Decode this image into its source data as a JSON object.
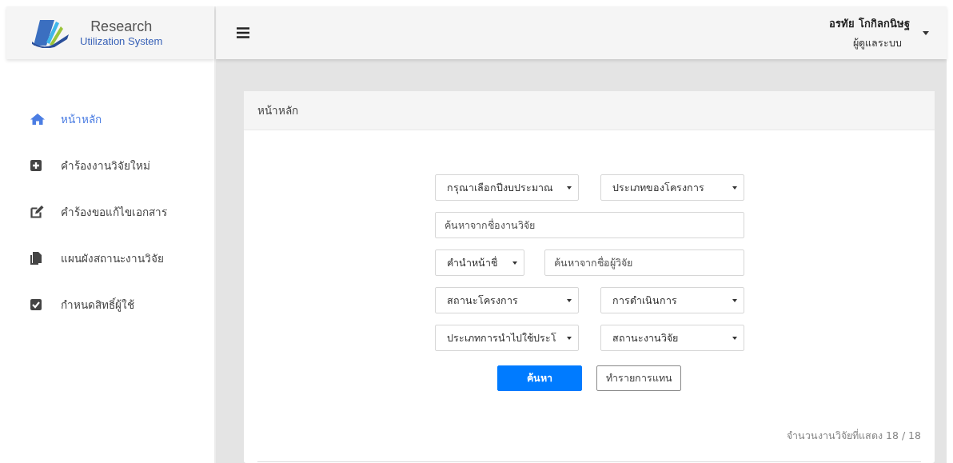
{
  "brand": {
    "title": "Research",
    "subtitle": "Utilization System"
  },
  "header": {
    "user_name": "อรทัย โกกิลกนิษฐ",
    "user_role": "ผู้ดูแลระบบ"
  },
  "sidebar": {
    "items": [
      {
        "label": "หน้าหลัก",
        "selected": true
      },
      {
        "label": "คำร้องงานวิจัยใหม่",
        "selected": false
      },
      {
        "label": "คำร้องขอแก้ไขเอกสาร",
        "selected": false
      },
      {
        "label": "แผนผังสถานะงานวิจัย",
        "selected": false
      },
      {
        "label": "กำหนดสิทธิ์ผู้ใช้",
        "selected": false
      }
    ]
  },
  "card": {
    "title": "หน้าหลัก",
    "filters": [
      [
        {
          "kind": "select",
          "value": "กรุณาเลือกปีงบประมาณ"
        },
        {
          "kind": "select",
          "value": "ประเภทของโครงการ"
        }
      ],
      [
        {
          "kind": "input",
          "placeholder": "ค้นหาจากชื่องานวิจัย"
        }
      ],
      [
        {
          "kind": "select",
          "value": "คำนำหน้าชื่"
        },
        {
          "kind": "input",
          "placeholder": "ค้นหาจากชื่อผู้วิจัย"
        }
      ],
      [
        {
          "kind": "select",
          "value": "สถานะโครงการ"
        },
        {
          "kind": "select",
          "value": "การดำเนินการ"
        }
      ],
      [
        {
          "kind": "select",
          "value": "ประเภทการนำไปใช้ประโ"
        },
        {
          "kind": "select",
          "value": "สถานะงานวิจัย"
        }
      ]
    ],
    "buttons": [
      {
        "label": "ค้นหา",
        "kind": "primary"
      },
      {
        "label": "ทำรายการแทน",
        "kind": "secondary"
      }
    ],
    "result_count": "จำนวนงานวิจัยที่แสดง 18 / 18"
  }
}
